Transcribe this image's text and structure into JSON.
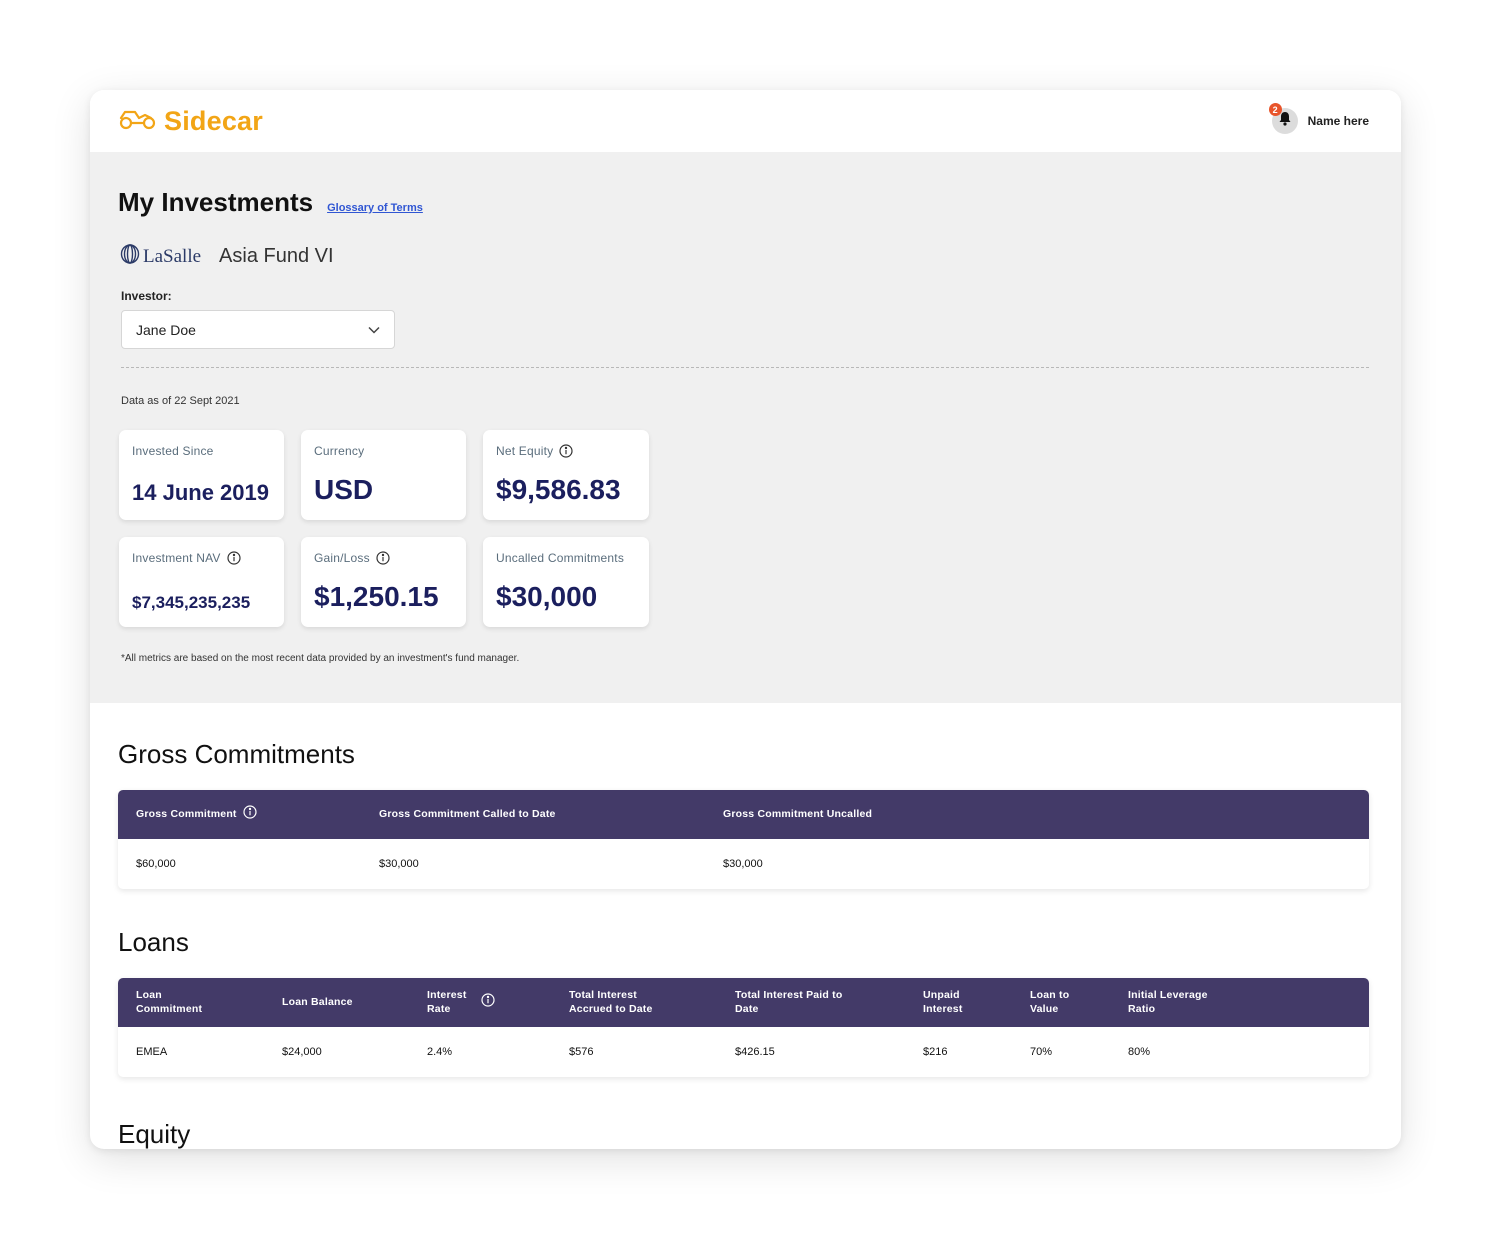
{
  "app": {
    "brand": "Sidecar",
    "user_name": "Name here",
    "notification_count": "2",
    "brand_color": "#F2A516"
  },
  "overview": {
    "title": "My Investments",
    "glossary_link": "Glossary of Terms",
    "sponsor_logo_text": "LaSalle",
    "fund_name": "Asia Fund VI",
    "investor_label": "Investor:",
    "investor_selected": "Jane Doe",
    "data_as_of": "Data as of 22 Sept 2021",
    "footnote": "*All metrics are based on the most recent data provided by an investment's fund manager."
  },
  "metrics": [
    {
      "label": "Invested Since",
      "value": "14 June 2019",
      "info": false
    },
    {
      "label": "Currency",
      "value": "USD",
      "info": false
    },
    {
      "label": "Net Equity",
      "value": "$9,586.83",
      "info": true
    },
    {
      "label": "Investment NAV",
      "value": "$7,345,235,235",
      "info": true
    },
    {
      "label": "Gain/Loss",
      "value": "$1,250.15",
      "info": true
    },
    {
      "label": "Uncalled Commitments",
      "value": "$30,000",
      "info": false
    }
  ],
  "gross_commitments": {
    "title": "Gross Commitments",
    "headers": [
      "Gross Commitment",
      "Gross Commitment Called to Date",
      "Gross Commitment Uncalled"
    ],
    "row": [
      "$60,000",
      "$30,000",
      "$30,000"
    ]
  },
  "loans": {
    "title": "Loans",
    "headers": [
      "Loan Commitment",
      "Loan Balance",
      "Interest Rate",
      "Total Interest Accrued to Date",
      "Total Interest Paid to Date",
      "Unpaid Interest",
      "Loan to Value",
      "Initial Leverage Ratio"
    ],
    "row": [
      "EMEA",
      "$24,000",
      "2.4%",
      "$576",
      "$426.15",
      "$216",
      "70%",
      "80%"
    ]
  },
  "equity": {
    "title": "Equity"
  },
  "colors": {
    "table_header": "#433a68",
    "metric_value": "#1b1f5e",
    "link": "#3056D3",
    "badge": "#E8542A"
  }
}
